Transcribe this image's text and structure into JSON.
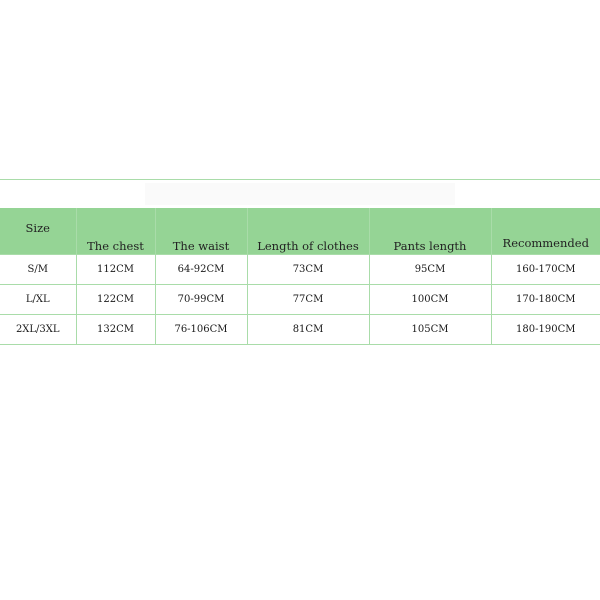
{
  "size_chart": {
    "headers": [
      "Size",
      "The chest",
      "The waist",
      "Length of clothes",
      "Pants length",
      "Recommended"
    ],
    "rows": [
      [
        "S/M",
        "112CM",
        "64-92CM",
        "73CM",
        "95CM",
        "160-170CM"
      ],
      [
        "L/XL",
        "122CM",
        "70-99CM",
        "77CM",
        "100CM",
        "170-180CM"
      ],
      [
        "2XL/3XL",
        "132CM",
        "76-106CM",
        "81CM",
        "105CM",
        "180-190CM"
      ]
    ]
  },
  "colors": {
    "header_background": "#95d495",
    "border": "#a9dca9"
  }
}
